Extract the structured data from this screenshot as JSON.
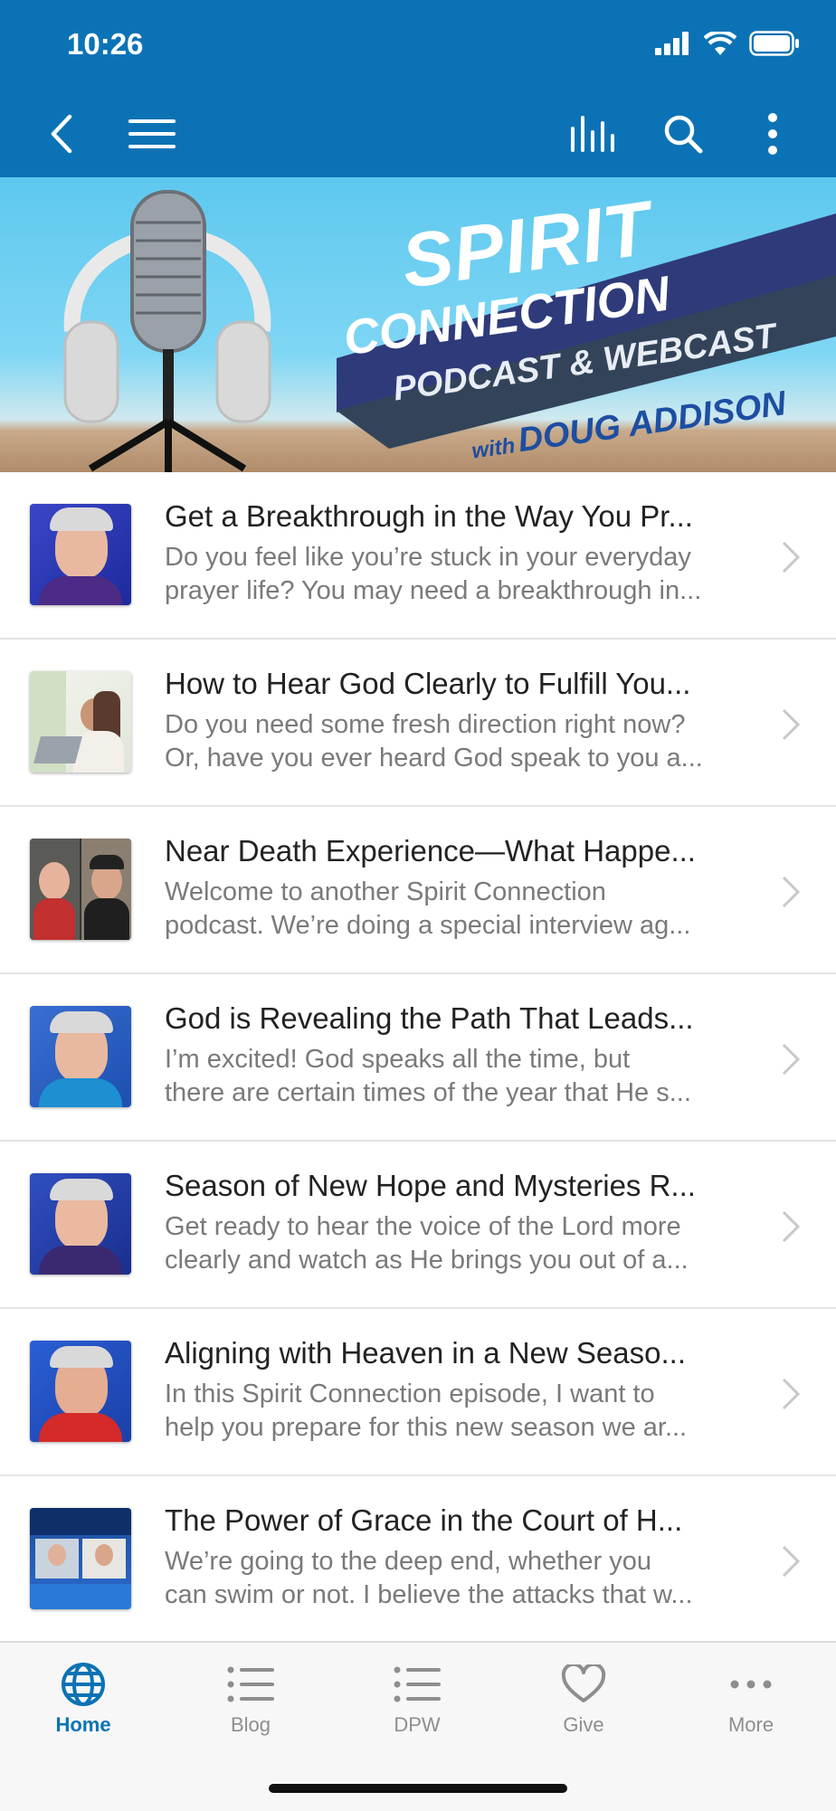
{
  "status": {
    "time": "10:26"
  },
  "header": {
    "back_icon": "chevron-left-icon",
    "menu_icon": "hamburger-icon",
    "stats_icon": "bars-icon",
    "search_icon": "search-icon",
    "more_icon": "vertical-ellipsis-icon",
    "color": "#0b73b5"
  },
  "banner": {
    "line1": "SPIRIT",
    "line2": "CONNECTION",
    "line3": "PODCAST & WEBCAST",
    "line4_prefix": "with",
    "line4_name": "DOUG ADDISON"
  },
  "episodes": [
    {
      "title": "Get a Breakthrough in the Way You Pr...",
      "desc1": "Do you feel like you’re stuck in your everyday",
      "desc2": "prayer life? You may need a breakthrough in..."
    },
    {
      "title": "How to Hear God Clearly to Fulfill You...",
      "desc1": "Do you need some fresh direction right now?",
      "desc2": "Or, have you ever heard God speak to you a..."
    },
    {
      "title": "Near Death Experience—What Happe...",
      "desc1": "Welcome to another Spirit Connection",
      "desc2": "podcast. We’re doing a special interview ag..."
    },
    {
      "title": "God is Revealing the Path That Leads...",
      "desc1": "I’m excited! God speaks all the time, but",
      "desc2": "there are certain times of the year that He s..."
    },
    {
      "title": "Season of New Hope and Mysteries R...",
      "desc1": "Get ready to hear the voice of the Lord more",
      "desc2": "clearly and watch as He brings you out of a..."
    },
    {
      "title": "Aligning with Heaven in a New Seaso...",
      "desc1": "In this Spirit Connection episode, I want to",
      "desc2": "help you prepare for this new season we ar..."
    },
    {
      "title": "The Power of Grace in the Court of H...",
      "desc1": "We’re going to the deep end, whether you",
      "desc2": "can swim or not. I believe the attacks that w..."
    }
  ],
  "tabs": [
    {
      "label": "Home",
      "icon": "globe-icon"
    },
    {
      "label": "Blog",
      "icon": "list-icon"
    },
    {
      "label": "DPW",
      "icon": "list-icon"
    },
    {
      "label": "Give",
      "icon": "heart-icon"
    },
    {
      "label": "More",
      "icon": "ellipsis-icon"
    }
  ]
}
